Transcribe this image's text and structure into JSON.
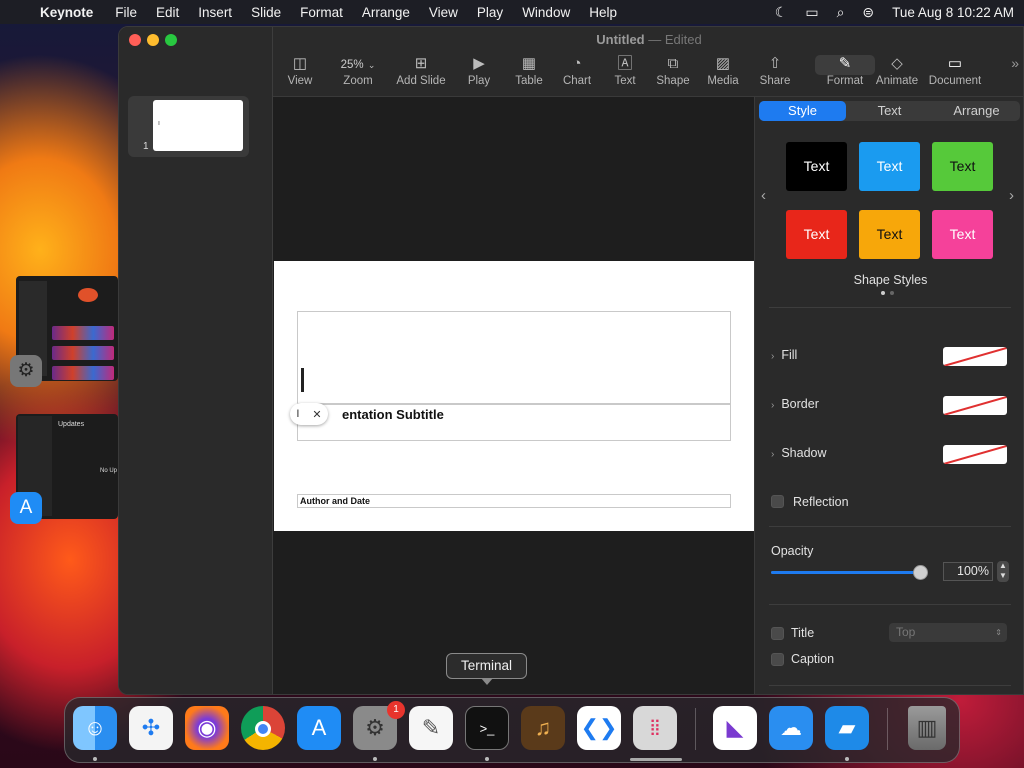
{
  "menubar": {
    "app_name": "Keynote",
    "items": [
      "File",
      "Edit",
      "Insert",
      "Slide",
      "Format",
      "Arrange",
      "View",
      "Play",
      "Window",
      "Help"
    ],
    "clock": "Tue Aug 8  10:22 AM"
  },
  "window": {
    "doc_name": "Untitled",
    "separator": "—",
    "doc_status": "Edited"
  },
  "toolbar": {
    "view": "View",
    "zoom_value": "25%",
    "zoom": "Zoom",
    "add_slide": "Add Slide",
    "play": "Play",
    "table": "Table",
    "chart": "Chart",
    "text": "Text",
    "shape": "Shape",
    "media": "Media",
    "share": "Share",
    "format": "Format",
    "animate": "Animate",
    "document": "Document"
  },
  "navigator": {
    "slide_number": "1"
  },
  "slide": {
    "subtitle": "entation Subtitle",
    "author": "Author and Date"
  },
  "inspector": {
    "tabs": [
      "Style",
      "Text",
      "Arrange"
    ],
    "swatch_text": "Text",
    "shape_styles_label": "Shape Styles",
    "fill_label": "Fill",
    "border_label": "Border",
    "shadow_label": "Shadow",
    "reflection_label": "Reflection",
    "opacity_label": "Opacity",
    "opacity_value": "100%",
    "opacity_fraction": 1.0,
    "title_label": "Title",
    "title_position": "Top",
    "caption_label": "Caption",
    "swatch_colors": [
      "#000000",
      "#1a9bf0",
      "#56c93a",
      "#e8261a",
      "#f7a70a",
      "#f5419a"
    ],
    "accent_color": "#1e7bf0"
  },
  "stage": {
    "updates_title": "Updates",
    "updates_message": "No Up"
  },
  "dock": {
    "tooltip": "Terminal",
    "badge": "1"
  }
}
